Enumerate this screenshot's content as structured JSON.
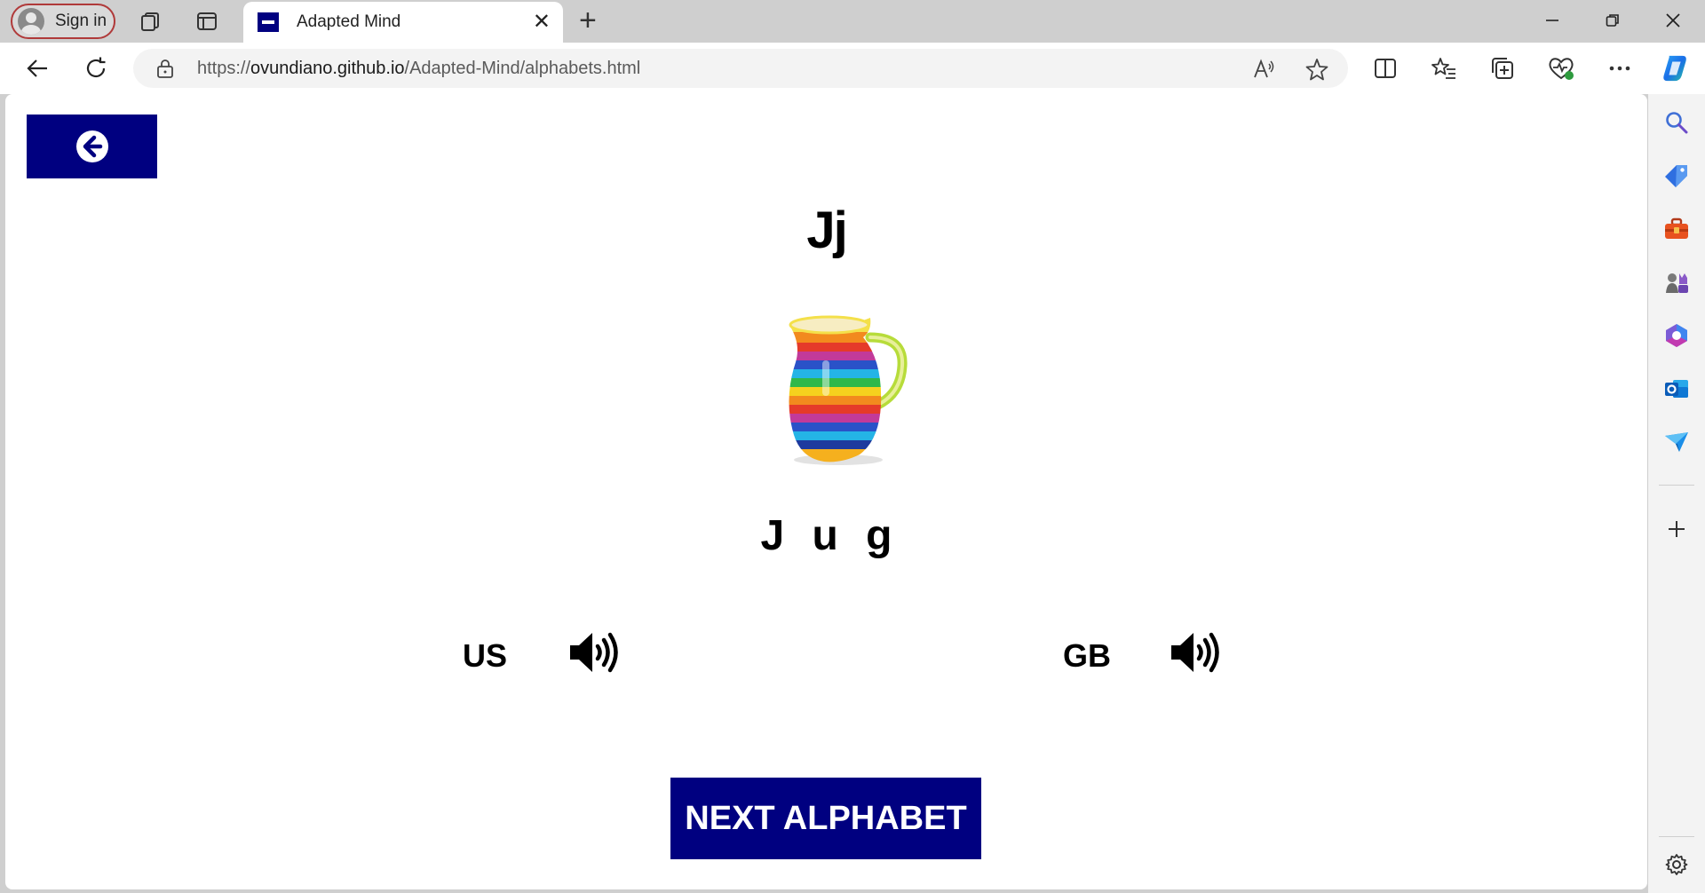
{
  "browser": {
    "sign_in_label": "Sign in",
    "tab_title": "Adapted Mind",
    "url_prefix": "https://",
    "url_host": "ovundiano.github.io",
    "url_path": "/Adapted-Mind/alphabets.html",
    "accent_color": "#000080"
  },
  "page": {
    "letter": "Jj",
    "word": "J u g",
    "image_name": "rainbow-striped-jug",
    "pronunciations": [
      {
        "label": "US"
      },
      {
        "label": "GB"
      }
    ],
    "next_button_label": "NEXT ALPHABET"
  }
}
